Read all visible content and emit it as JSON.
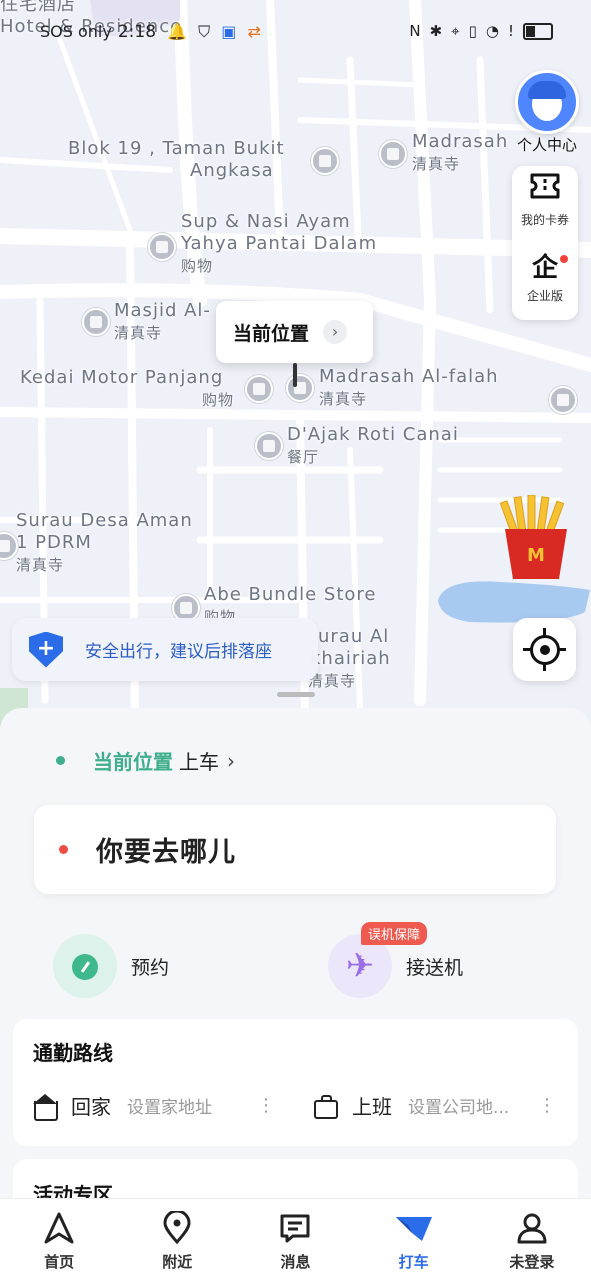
{
  "status_bar": {
    "left_text": "SOS only",
    "time": "2:18",
    "right_icons": [
      "nfc-icon",
      "bluetooth-icon",
      "location-icon",
      "vibrate-icon",
      "wifi-icon",
      "alert-icon",
      "battery-icon"
    ]
  },
  "map": {
    "top_labels": {
      "line1": "住宅酒店",
      "line2": "Hotel & Residence"
    },
    "pois": [
      {
        "name": "Blok 19 , Taman Bukit",
        "name2": "Angkasa",
        "sub": ""
      },
      {
        "name": "Madrasah",
        "name2": "",
        "sub": "清真寺"
      },
      {
        "name": "Sup & Nasi Ayam",
        "name2": "Yahya Pantai Dalam",
        "sub": "购物"
      },
      {
        "name": "Masjid Al-",
        "name2": "",
        "sub": "清真寺"
      },
      {
        "name": "Kedai Motor Panjang",
        "name2": "",
        "sub": "购物"
      },
      {
        "name": "Madrasah Al-falah",
        "name2": "",
        "sub": "清真寺"
      },
      {
        "name": "D'Ajak Roti Canai",
        "name2": "",
        "sub": "餐厅"
      },
      {
        "name": "Surau Desa Aman",
        "name2": "1 PDRM",
        "sub": "清真寺"
      },
      {
        "name": "Abe Bundle Store",
        "name2": "",
        "sub": "购物"
      },
      {
        "name": "urau Al",
        "name2": "khairiah",
        "sub": "清真寺"
      }
    ],
    "current_location_label": "当前位置",
    "safety_tip": "安全出行，建议后排落座"
  },
  "side_panel": {
    "profile_label": "个人中心",
    "items": [
      {
        "label": "我的卡券",
        "icon": "coupon-icon"
      },
      {
        "label": "企业版",
        "icon": "enterprise-icon",
        "glyph": "企"
      }
    ]
  },
  "sheet": {
    "pickup_location": "当前位置",
    "pickup_suffix": "上车",
    "destination_placeholder": "你要去哪儿",
    "services": [
      {
        "label": "预约",
        "icon": "clock-icon"
      },
      {
        "label": "接送机",
        "icon": "airplane-icon",
        "badge": "误机保障"
      }
    ],
    "commute": {
      "title": "通勤路线",
      "home": {
        "label": "回家",
        "hint": "设置家地址"
      },
      "work": {
        "label": "上班",
        "hint": "设置公司地..."
      }
    },
    "activity_title": "活动专区"
  },
  "tabs": [
    {
      "label": "首页",
      "icon": "home-nav-icon",
      "active": false
    },
    {
      "label": "附近",
      "icon": "nearby-pin-icon",
      "active": false
    },
    {
      "label": "消息",
      "icon": "message-icon",
      "active": false
    },
    {
      "label": "打车",
      "icon": "taxi-icon",
      "active": true
    },
    {
      "label": "未登录",
      "icon": "user-icon",
      "active": false
    }
  ],
  "colors": {
    "accent": "#2b6de8",
    "green": "#3fae8b",
    "red": "#ee4c45",
    "map_bg": "#eef1f8"
  }
}
